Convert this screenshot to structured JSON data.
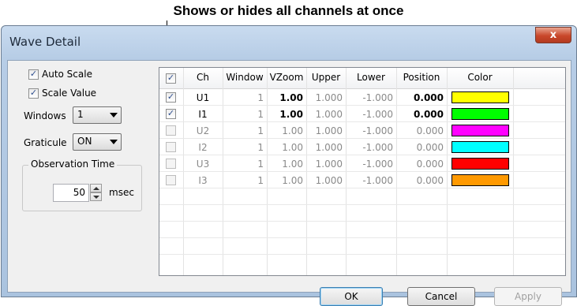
{
  "callout": "Shows or hides all channels at once",
  "window": {
    "title": "Wave Detail",
    "close_glyph": "x"
  },
  "left_panel": {
    "auto_scale": {
      "label": "Auto Scale",
      "checked": true
    },
    "scale_value": {
      "label": "Scale Value",
      "checked": true
    },
    "windows": {
      "label": "Windows",
      "value": "1"
    },
    "graticule": {
      "label": "Graticule",
      "value": "ON"
    },
    "observation_time": {
      "title": "Observation Time",
      "value": "50",
      "unit": "msec"
    }
  },
  "table": {
    "header_checked": true,
    "columns": [
      "Ch",
      "Window",
      "VZoom",
      "Upper",
      "Lower",
      "Position",
      "Color"
    ],
    "rows": [
      {
        "checked": true,
        "ch": "U1",
        "window": "1",
        "vzoom": "1.00",
        "upper": "1.000",
        "lower": "-1.000",
        "position": "0.000",
        "color": "#ffff00"
      },
      {
        "checked": true,
        "ch": "I1",
        "window": "1",
        "vzoom": "1.00",
        "upper": "1.000",
        "lower": "-1.000",
        "position": "0.000",
        "color": "#00ff00"
      },
      {
        "checked": false,
        "ch": "U2",
        "window": "1",
        "vzoom": "1.00",
        "upper": "1.000",
        "lower": "-1.000",
        "position": "0.000",
        "color": "#ff00ff"
      },
      {
        "checked": false,
        "ch": "I2",
        "window": "1",
        "vzoom": "1.00",
        "upper": "1.000",
        "lower": "-1.000",
        "position": "0.000",
        "color": "#00ffff"
      },
      {
        "checked": false,
        "ch": "U3",
        "window": "1",
        "vzoom": "1.00",
        "upper": "1.000",
        "lower": "-1.000",
        "position": "0.000",
        "color": "#ff0000"
      },
      {
        "checked": false,
        "ch": "I3",
        "window": "1",
        "vzoom": "1.00",
        "upper": "1.000",
        "lower": "-1.000",
        "position": "0.000",
        "color": "#ff9900"
      }
    ]
  },
  "buttons": {
    "ok": "OK",
    "cancel": "Cancel",
    "apply": "Apply"
  }
}
